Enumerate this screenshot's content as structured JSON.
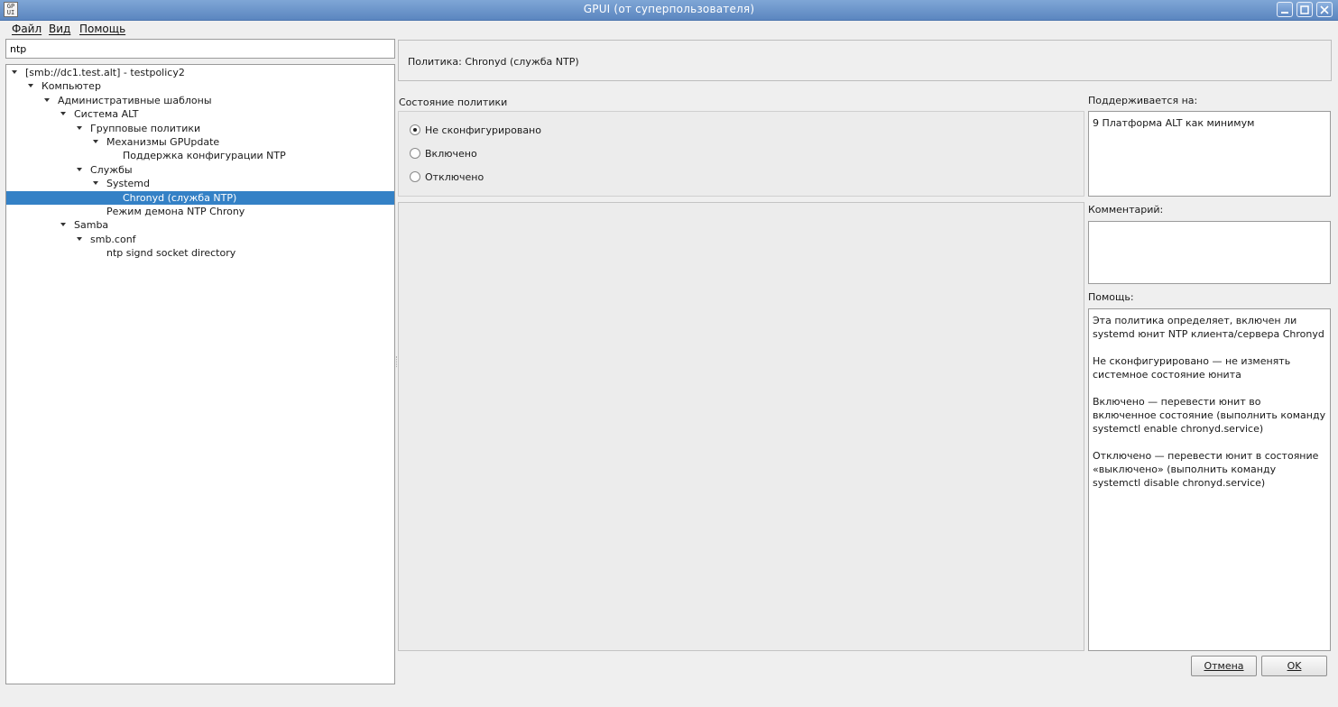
{
  "window": {
    "title": "GPUI (от суперпользователя)",
    "app_icon_text": "GP\nUI",
    "controls": [
      "minimize-icon",
      "maximize-icon",
      "close-icon"
    ]
  },
  "menu": {
    "file": "Файл",
    "view": "Вид",
    "help": "Помощь"
  },
  "search": {
    "value": "ntp"
  },
  "tree": {
    "items": [
      {
        "label": "[smb://dc1.test.alt] - testpolicy2",
        "expanded": true,
        "selected": false
      },
      {
        "label": "Компьютер",
        "expanded": true,
        "selected": false
      },
      {
        "label": "Административные шаблоны",
        "expanded": true,
        "selected": false
      },
      {
        "label": "Система ALT",
        "expanded": true,
        "selected": false
      },
      {
        "label": "Групповые политики",
        "expanded": true,
        "selected": false
      },
      {
        "label": "Механизмы GPUpdate",
        "expanded": true,
        "selected": false
      },
      {
        "label": "Поддержка конфигурации NTP",
        "expanded": false,
        "selected": false
      },
      {
        "label": "Службы",
        "expanded": true,
        "selected": false
      },
      {
        "label": "Systemd",
        "expanded": true,
        "selected": false
      },
      {
        "label": "Chronyd (служба NTP)",
        "expanded": false,
        "selected": true
      },
      {
        "label": "Режим демона NTP Chrony",
        "expanded": false,
        "selected": false
      },
      {
        "label": "Samba",
        "expanded": true,
        "selected": false
      },
      {
        "label": "smb.conf",
        "expanded": true,
        "selected": false
      },
      {
        "label": "ntp signd socket directory",
        "expanded": false,
        "selected": false
      }
    ]
  },
  "policy": {
    "header": "Политика: Chronyd (служба NTP)",
    "state_label": "Состояние политики",
    "options": [
      {
        "label": "Не сконфигурировано",
        "checked": true
      },
      {
        "label": "Включено",
        "checked": false
      },
      {
        "label": "Отключено",
        "checked": false
      }
    ]
  },
  "supported": {
    "label": "Поддерживается на:",
    "value": "9 Платформа ALT как минимум"
  },
  "comment": {
    "label": "Комментарий:",
    "value": ""
  },
  "help": {
    "label": "Помощь:",
    "paragraphs": [
      "Эта политика определяет, включен ли systemd юнит NTP клиента/сервера Chronyd",
      "Не сконфигурировано — не изменять системное состояние юнита",
      "Включено — перевести юнит во включенное состояние (выполнить команду systemctl enable chronyd.service)",
      "Отключено — перевести юнит в состояние «выключено» (выполнить команду systemctl disable chronyd.service)"
    ]
  },
  "buttons": {
    "cancel": "Отмена",
    "ok": "OK"
  },
  "colors": {
    "titlebar": "#5b86c0",
    "selection": "#3481c6",
    "background": "#efefef"
  }
}
